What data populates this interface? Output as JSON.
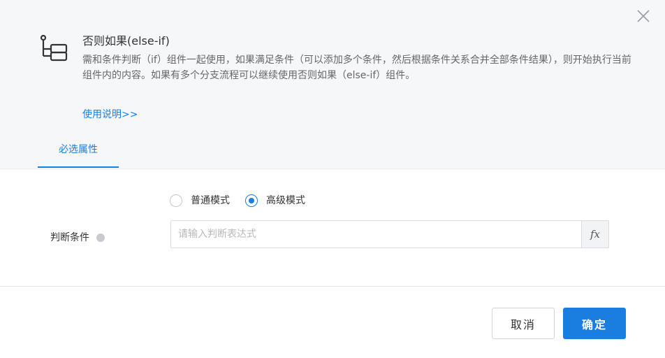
{
  "dialog": {
    "component": {
      "icon": "condition-branch-icon",
      "title": "否则如果(else-if)",
      "description": "需和条件判断（if）组件一起使用，如果满足条件（可以添加多个条件，然后根据条件关系合并全部条件结果），则开始执行当前组件内的内容。如果有多个分支流程可以继续使用否则如果（else-if）组件。",
      "usage_link": "使用说明>>"
    },
    "tabs": [
      {
        "label": "必选属性",
        "active": true
      }
    ],
    "mode": {
      "options": [
        {
          "label": "普通模式",
          "checked": false
        },
        {
          "label": "高级模式",
          "checked": true
        }
      ]
    },
    "condition": {
      "label": "判断条件",
      "value": "",
      "placeholder": "请输入判断表达式",
      "fx_label": "fx"
    },
    "footer": {
      "cancel_label": "取消",
      "ok_label": "确定"
    }
  },
  "colors": {
    "accent": "#1a7ee0",
    "header_bg": "#f6f7f9"
  }
}
